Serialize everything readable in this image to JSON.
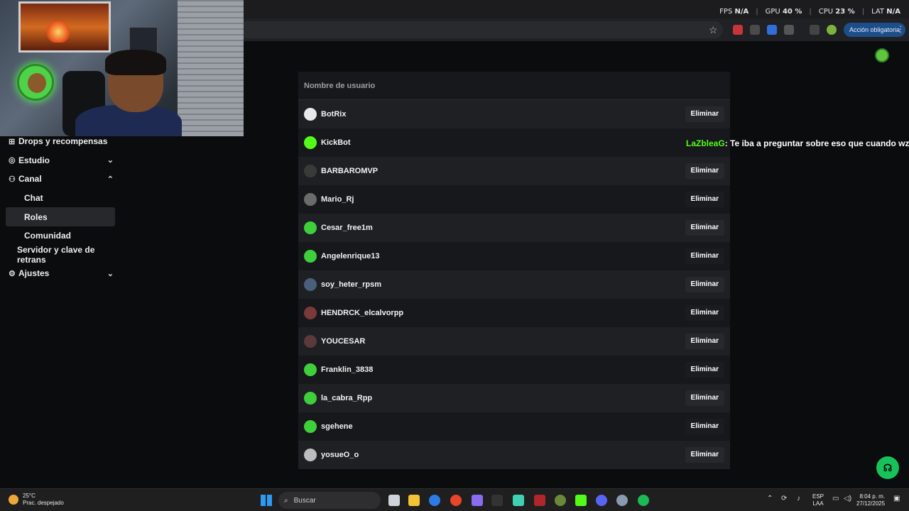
{
  "overlay": {
    "fps_label": "FPS",
    "fps_value": "N/A",
    "gpu_label": "GPU",
    "gpu_value": "40 %",
    "cpu_label": "CPU",
    "cpu_value": "23 %",
    "lat_label": "LAT",
    "lat_value": "N/A"
  },
  "browser": {
    "mandatory_action": "Acción obligatoria"
  },
  "sidebar": {
    "items": [
      {
        "label": "Drops y recompensas",
        "icon": "gift-icon"
      },
      {
        "label": "Estudio",
        "icon": "studio-icon"
      },
      {
        "label": "Canal",
        "icon": "channel-icon"
      },
      {
        "label": "Chat"
      },
      {
        "label": "Roles"
      },
      {
        "label": "Comunidad"
      },
      {
        "label": "Servidor y clave de retrans"
      },
      {
        "label": "Ajustes",
        "icon": "gear-icon"
      }
    ]
  },
  "roles": {
    "column_header": "Nombre de usuario",
    "delete_label": "Eliminar",
    "users": [
      {
        "name": "BotRix",
        "avatar_color": "#e9e9e9"
      },
      {
        "name": "KickBot",
        "avatar_color": "#53fc18"
      },
      {
        "name": "BARBAROMVP",
        "avatar_color": "#3a3a3a"
      },
      {
        "name": "Mario_Rj",
        "avatar_color": "#6b6b6b"
      },
      {
        "name": "Cesar_free1m",
        "avatar_color": "#3fcf3a"
      },
      {
        "name": "Angelenrique13",
        "avatar_color": "#3fcf3a"
      },
      {
        "name": "soy_heter_rpsm",
        "avatar_color": "#4a5f7a"
      },
      {
        "name": "HENDRCK_elcalvorpp",
        "avatar_color": "#7a3a3a"
      },
      {
        "name": "YOUCESAR",
        "avatar_color": "#5a3a3a"
      },
      {
        "name": "Franklin_3838",
        "avatar_color": "#3fcf3a"
      },
      {
        "name": "la_cabra_Rpp",
        "avatar_color": "#3fcf3a"
      },
      {
        "name": "sgehene",
        "avatar_color": "#3fcf3a"
      },
      {
        "name": "yosueO_o",
        "avatar_color": "#bdbdbd"
      }
    ]
  },
  "chat_overlay": {
    "username": "LaZbleaG",
    "message": ": Te iba a preguntar sobre eso que cuando wz"
  },
  "taskbar": {
    "temperature": "25°C",
    "weather": "Prac. despejado",
    "search_placeholder": "Buscar",
    "lang_top": "ESP",
    "lang_bottom": "LAA",
    "time": "8:04 p. m.",
    "date": "27/12/2025"
  }
}
